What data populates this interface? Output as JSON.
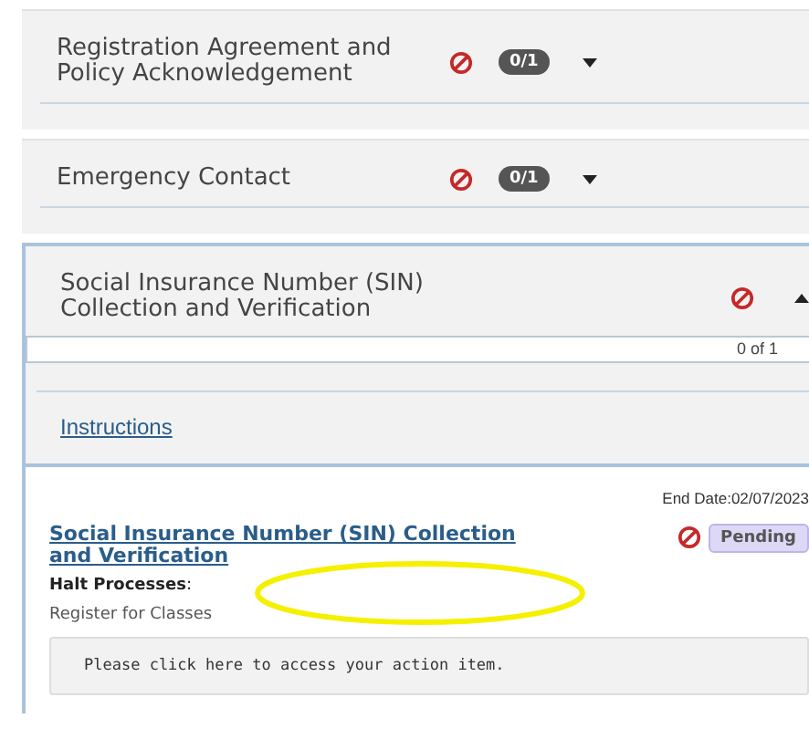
{
  "sections": [
    {
      "title": "Registration Agreement and Policy Acknowledgement",
      "blocked": true,
      "count": "0/1",
      "expanded": false
    },
    {
      "title": "Emergency Contact",
      "blocked": true,
      "count": "0/1",
      "expanded": false
    },
    {
      "title": "Social Insurance Number (SIN) Collection and Verification",
      "blocked": true,
      "expanded": true,
      "progress": {
        "level": 0,
        "reading": "0 of 1"
      },
      "instructions_link": "Instructions",
      "items": [
        {
          "end_date": "End Date:02/07/2023",
          "title": "Social Insurance Number (SIN) Collection and Verification",
          "status": "Pending",
          "halt_label": "Halt Processes",
          "halt_colon": ":",
          "halt_value": "Register for Classes",
          "action": "Please click here to access your action item."
        }
      ]
    }
  ],
  "annotation": {
    "kind": "ellipse"
  }
}
